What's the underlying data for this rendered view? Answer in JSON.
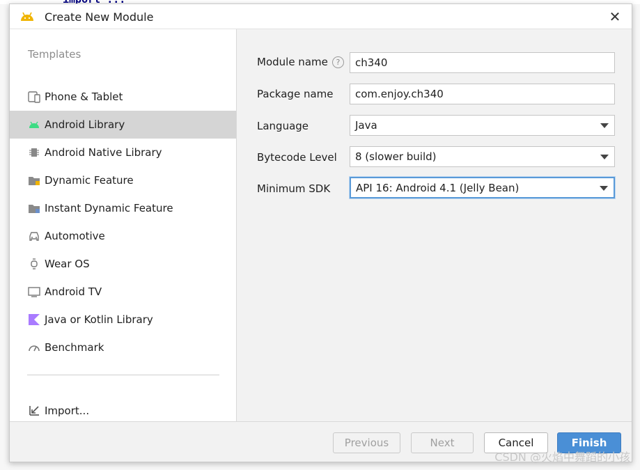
{
  "background": {
    "code_fragment": "import ..."
  },
  "dialog": {
    "title": "Create New Module",
    "close_glyph": "✕"
  },
  "sidebar": {
    "heading": "Templates",
    "items": [
      {
        "label": "Phone & Tablet",
        "icon": "phone-tablet-icon",
        "selected": false
      },
      {
        "label": "Android Library",
        "icon": "android-icon",
        "selected": true
      },
      {
        "label": "Android Native Library",
        "icon": "native-library-icon",
        "selected": false
      },
      {
        "label": "Dynamic Feature",
        "icon": "dynamic-feature-icon",
        "selected": false
      },
      {
        "label": "Instant Dynamic Feature",
        "icon": "instant-dynamic-feature-icon",
        "selected": false
      },
      {
        "label": "Automotive",
        "icon": "car-icon",
        "selected": false
      },
      {
        "label": "Wear OS",
        "icon": "watch-icon",
        "selected": false
      },
      {
        "label": "Android TV",
        "icon": "tv-icon",
        "selected": false
      },
      {
        "label": "Java or Kotlin Library",
        "icon": "kotlin-icon",
        "selected": false
      },
      {
        "label": "Benchmark",
        "icon": "gauge-icon",
        "selected": false
      }
    ],
    "import_label": "Import..."
  },
  "form": {
    "module_name": {
      "label": "Module name",
      "value": "ch340",
      "help_glyph": "?"
    },
    "package_name": {
      "label": "Package name",
      "value": "com.enjoy.ch340"
    },
    "language": {
      "label": "Language",
      "value": "Java"
    },
    "bytecode_level": {
      "label": "Bytecode Level",
      "value": "8 (slower build)"
    },
    "minimum_sdk": {
      "label": "Minimum SDK",
      "value": "API 16: Android 4.1 (Jelly Bean)"
    }
  },
  "footer": {
    "previous_label": "Previous",
    "next_label": "Next",
    "cancel_label": "Cancel",
    "finish_label": "Finish"
  },
  "watermark": "CSDN @火焰中舞蹈的小孩",
  "colors": {
    "accent": "#4a8fd6",
    "selection": "#d5d5d5",
    "android_green": "#3ddc84",
    "kotlin_purple": "#a97bff"
  }
}
